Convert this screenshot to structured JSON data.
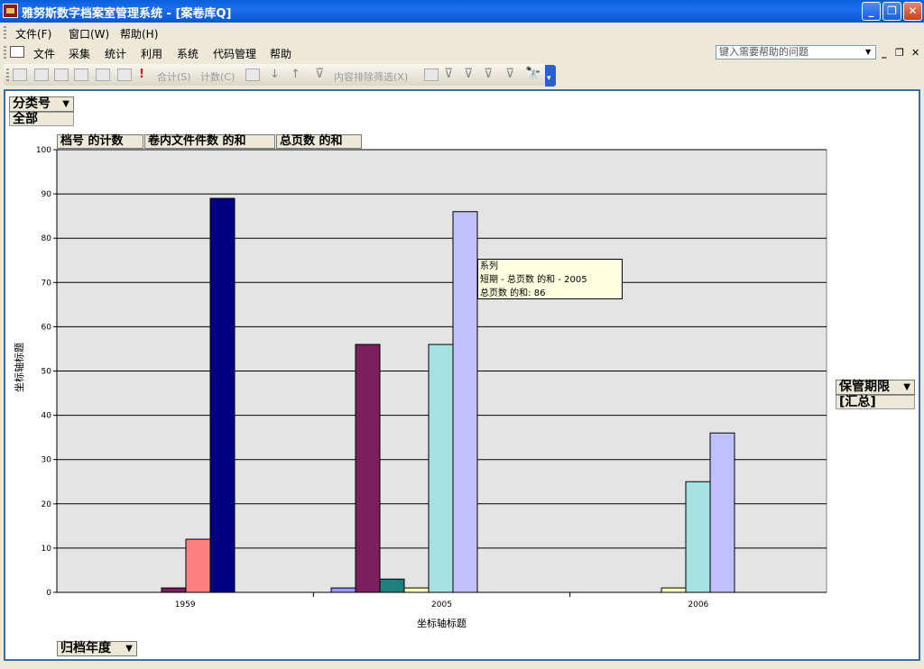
{
  "window": {
    "title": "雅努斯数字档案室管理系统 - [案卷库Q]"
  },
  "menubar1": [
    {
      "label": "文件(F)"
    },
    {
      "label": "窗口(W)"
    },
    {
      "label": "帮助(H)"
    }
  ],
  "menubar2": [
    {
      "label": "文件"
    },
    {
      "label": "采集"
    },
    {
      "label": "统计"
    },
    {
      "label": "利用"
    },
    {
      "label": "系统"
    },
    {
      "label": "代码管理"
    },
    {
      "label": "帮助"
    }
  ],
  "help": {
    "placeholder": "键入需要帮助的问题"
  },
  "toolbar": {
    "sum_label": "合计(S)",
    "count_label": "计数(C)",
    "exclude_filter_label": "内容排除筛选(X)"
  },
  "pivot": {
    "filter_field": "分类号",
    "filter_value": "全部",
    "data_fields": [
      "档号 的计数",
      "卷内文件件数 的和",
      "总页数 的和"
    ],
    "series_field": "保管期限",
    "series_value": "[汇总]",
    "category_field": "归档年度"
  },
  "tooltip": {
    "line1": "系列",
    "line2": "短期 - 总页数 的和 - 2005",
    "line3": "总页数 的和: 86"
  },
  "chart_data": {
    "type": "bar",
    "categories": [
      "1959",
      "2005",
      "2006"
    ],
    "xlabel": "坐标轴标题",
    "ylabel": "坐标轴标题",
    "ylim": [
      0,
      100
    ],
    "yticks": [
      0,
      10,
      20,
      30,
      40,
      50,
      60,
      70,
      80,
      90,
      100
    ],
    "grid": true,
    "series": [
      {
        "color": "#9999ff",
        "values": [
          0,
          1,
          0
        ]
      },
      {
        "color": "#7b1f5e",
        "values": [
          1,
          56,
          0
        ]
      },
      {
        "color": "#1f7f7f",
        "values": [
          0,
          3,
          0
        ]
      },
      {
        "color": "#ffffc0",
        "values": [
          0,
          1,
          1
        ]
      },
      {
        "color": "#ff8080",
        "values": [
          12,
          0,
          0
        ]
      },
      {
        "color": "#a6e0e0",
        "values": [
          0,
          56,
          25
        ]
      },
      {
        "color": "#000080",
        "values": [
          89,
          0,
          0
        ]
      },
      {
        "color": "#c0c0ff",
        "values": [
          0,
          86,
          36
        ]
      }
    ]
  }
}
